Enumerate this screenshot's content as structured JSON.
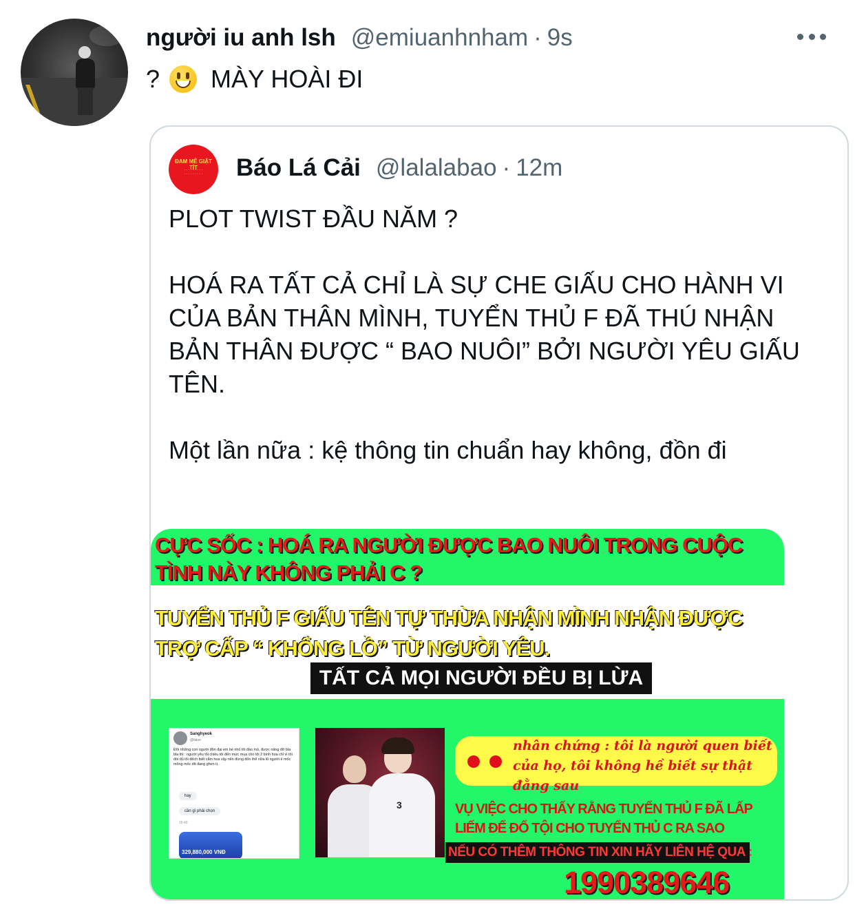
{
  "tweet": {
    "name": "người iu anh lsh",
    "handle": "@emiuanhnham",
    "separator": "·",
    "time": "9s",
    "text_prefix": "?",
    "emoji": "smiley-emoji",
    "text": "MÀY HOÀI ĐI"
  },
  "quote": {
    "avatar_text": "ĐAM MÊ GIẬT TÍT",
    "name": "Báo Lá Cải",
    "handle": "@lalalabao",
    "separator": "·",
    "time": "12m",
    "paragraphs": [
      "PLOT TWIST ĐẦU NĂM ?",
      "HOÁ RA TẤT CẢ CHỈ LÀ SỰ CHE GIẤU CHO HÀNH VI CỦA BẢN THÂN MÌNH, TUYỂN THỦ F ĐÃ THÚ NHẬN BẢN THÂN ĐƯỢC “ BAO NUÔI” BỞI NGƯỜI YÊU GIẤU TÊN.",
      "Một lần nữa : kệ thông tin chuẩn hay không, đồn đi"
    ]
  },
  "media": {
    "headline": "CỰC SỐC : HOÁ RA NGƯỜI ĐƯỢC BAO NUÔI TRONG CUỘC TÌNH NÀY KHÔNG PHẢI C ?",
    "subheadline": "TUYỂN THỦ F GIẤU TÊN TỰ THỪA NHẬN MÌNH NHẬN ĐƯỢC TRỢ CẤP “ KHỔNG LỒ” TỪ NGƯỜI YÊU.",
    "blackbar": "TẤT CẢ MỌI NGƯỜI ĐỀU BỊ LỪA ?!",
    "screenshot": {
      "user": "Sanghyeok",
      "handle": "@faker",
      "text": "Đôi những con người đôn đại em bé nhỏ tôi đào mỏ, được nâng đỡ bla bla thì : người yêu tôi chiều tôi đến mức mua cho tôi 2 bình hoa chỉ vì tôi đòi đủ tôi đếch biết cắm hoa vậy nên đừng đốn thể nữa lũ người ế mốc mông mốc dít đang ghen tị.",
      "bubble1": "hay",
      "bubble2": "cần gì phải chọn",
      "time": "15:49",
      "amount": "329,880,000 VNĐ"
    },
    "photo_number": "3",
    "witness": "nhân chứng : tôi là người quen biết của họ, tôi không hề biết sự thật đằng sau",
    "incident": "VỤ VIỆC CHO THẤY RẰNG TUYỂN THỦ F ĐÃ LẤP LIẾM ĐỂ ĐỔ TỘI CHO TUYỂN THỦ C RA SAO",
    "contact": "NẾU CÓ THÊM THÔNG TIN XIN HÃY LIÊN HỆ QUA :",
    "phone": "1990389646"
  },
  "colors": {
    "green": "#22f76a",
    "red": "#e21b1b",
    "yellow": "#ffef3a",
    "muted": "#536471"
  }
}
